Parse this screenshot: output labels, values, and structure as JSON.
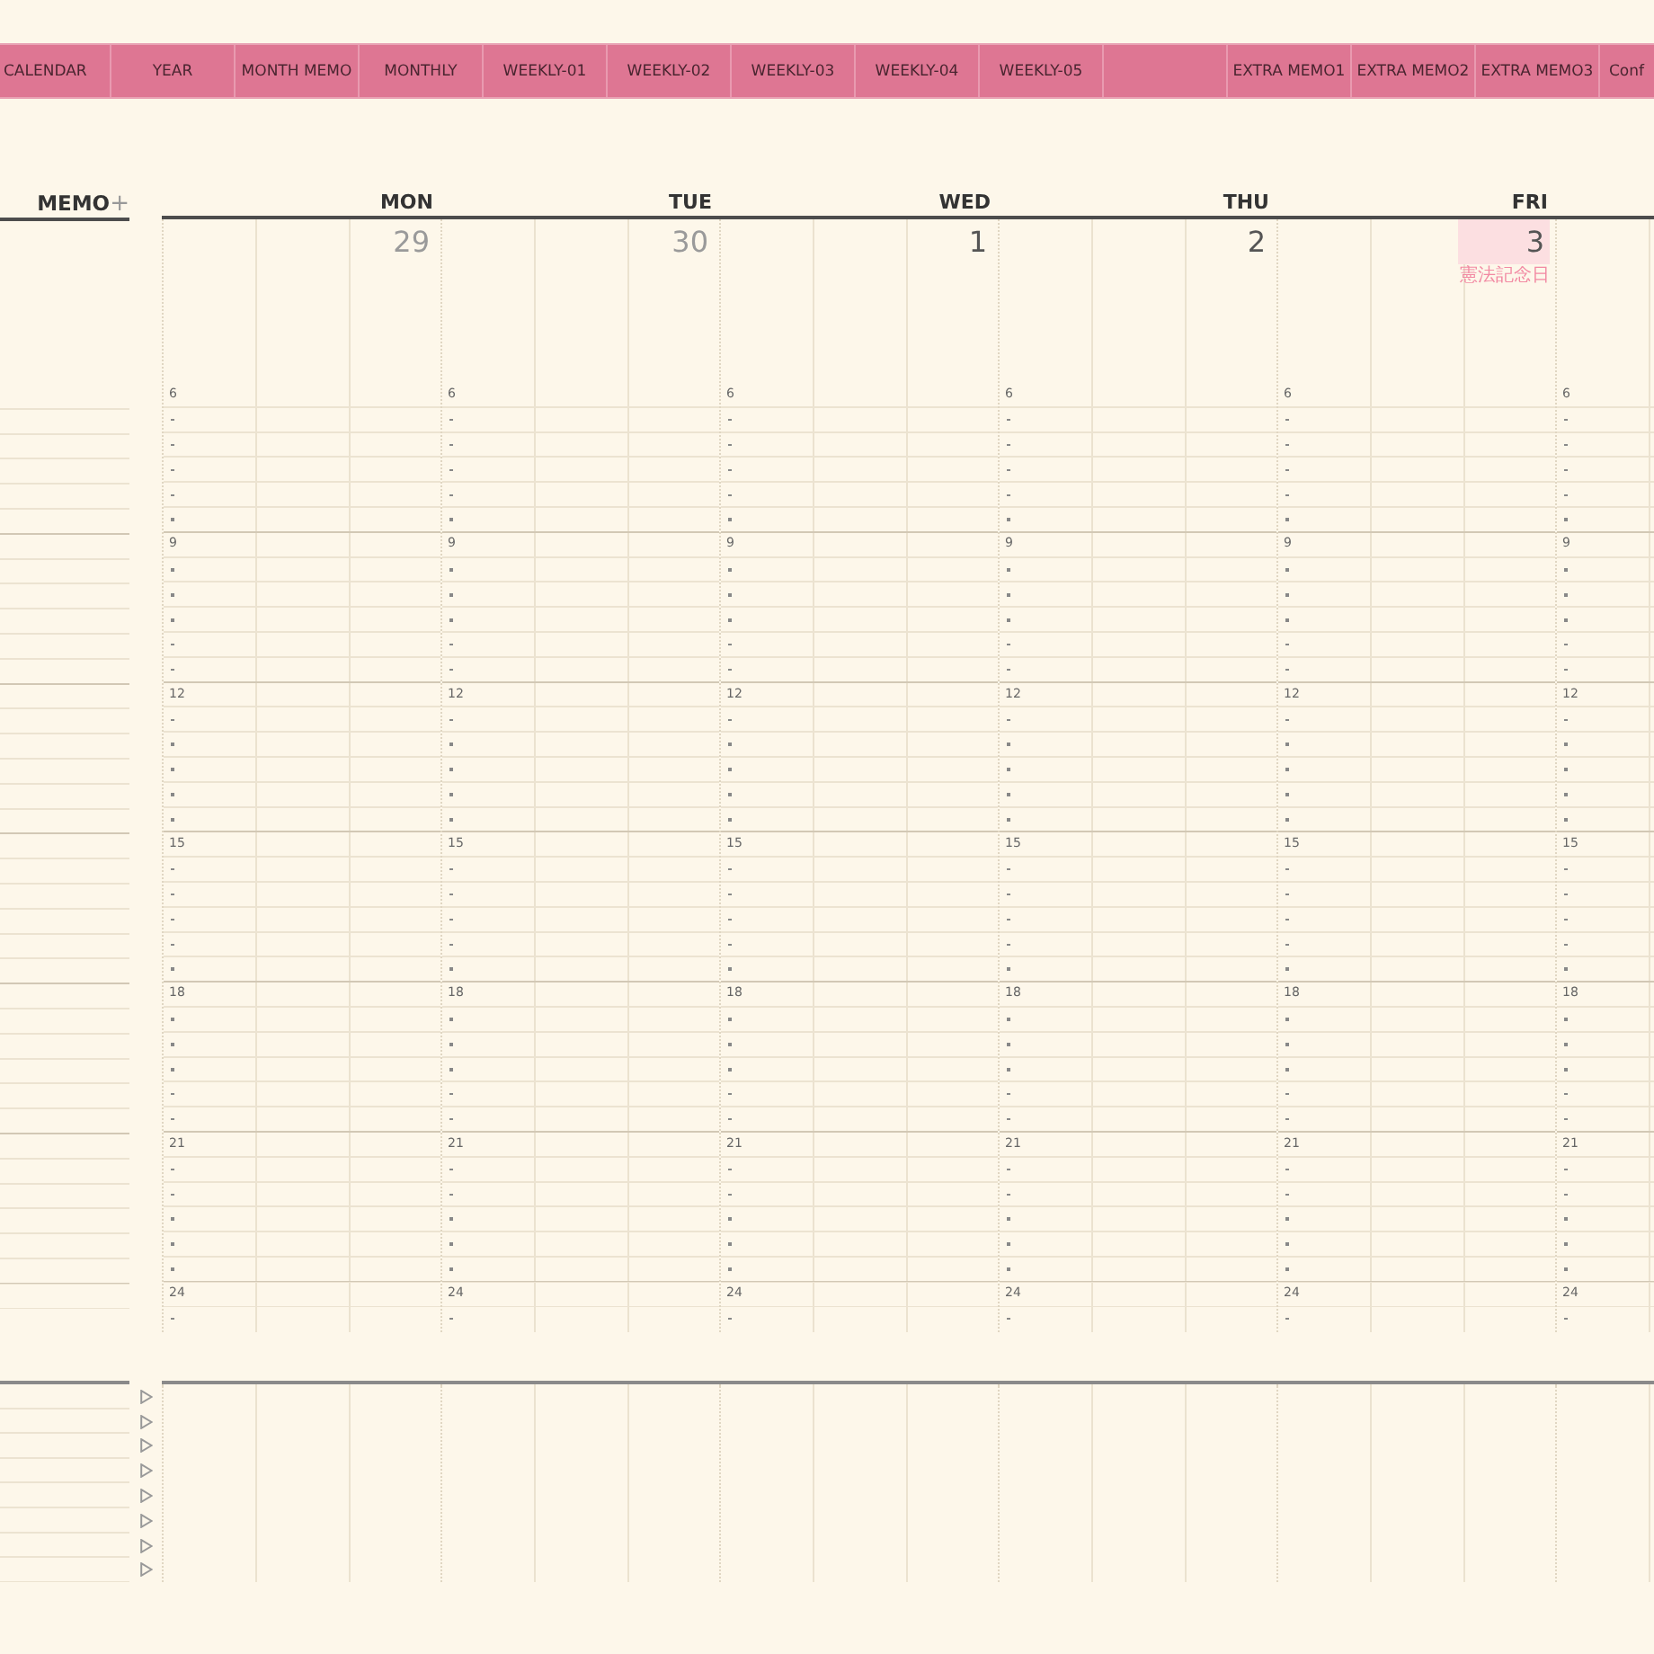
{
  "tabs": [
    {
      "kind": "tab",
      "label": "CALENDAR"
    },
    {
      "kind": "tab",
      "label": "YEAR"
    },
    {
      "kind": "tab",
      "label": "MONTH MEMO"
    },
    {
      "kind": "tab",
      "label": "MONTHLY"
    },
    {
      "kind": "tab",
      "label": "WEEKLY-01"
    },
    {
      "kind": "tab",
      "label": "WEEKLY-02"
    },
    {
      "kind": "tab",
      "label": "WEEKLY-03"
    },
    {
      "kind": "tab",
      "label": "WEEKLY-04"
    },
    {
      "kind": "tab",
      "label": "WEEKLY-05"
    },
    {
      "kind": "spacer"
    },
    {
      "kind": "tab",
      "label": "EXTRA MEMO1"
    },
    {
      "kind": "tab",
      "label": "EXTRA MEMO2"
    },
    {
      "kind": "tab",
      "label": "EXTRA MEMO3"
    },
    {
      "kind": "clipped",
      "label": "Conf"
    }
  ],
  "memo": {
    "title": "MEMO",
    "add_symbol": "+"
  },
  "days": [
    {
      "weekday": "MON",
      "date": "29",
      "in_month": false,
      "highlighted": false,
      "hour_labels": [
        "6",
        "9",
        "12",
        "15",
        "18",
        "21",
        "24"
      ]
    },
    {
      "weekday": "TUE",
      "date": "30",
      "in_month": false,
      "highlighted": false,
      "hour_labels": [
        "6",
        "9",
        "12",
        "15",
        "18",
        "21",
        "24"
      ]
    },
    {
      "weekday": "WED",
      "date": "1",
      "in_month": true,
      "highlighted": false,
      "hour_labels": [
        "6",
        "9",
        "12",
        "15",
        "18",
        "21",
        "24"
      ]
    },
    {
      "weekday": "THU",
      "date": "2",
      "in_month": true,
      "highlighted": false,
      "hour_labels": [
        "6",
        "9",
        "12",
        "15",
        "18",
        "21",
        "24"
      ]
    },
    {
      "weekday": "FRI",
      "date": "3",
      "in_month": true,
      "highlighted": true,
      "holiday": "憲法記念日",
      "hour_labels": [
        "6",
        "9",
        "12",
        "15",
        "18",
        "21",
        "24"
      ]
    },
    {
      "hour_labels": [
        "6",
        "9",
        "12",
        "15",
        "18",
        "21",
        "24"
      ]
    }
  ]
}
